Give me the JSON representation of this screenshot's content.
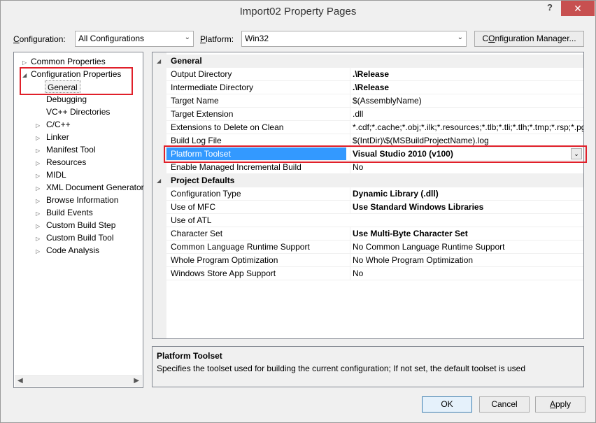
{
  "window": {
    "title": "Import02 Property Pages",
    "help_label": "?",
    "close_label": "✕"
  },
  "toolbar": {
    "configuration_label_prefix": "",
    "configuration_label_mnemonic": "C",
    "configuration_label_rest": "onfiguration:",
    "configuration_value": "All Configurations",
    "platform_label_mnemonic": "P",
    "platform_label_rest": "latform:",
    "platform_value": "Win32",
    "config_manager_mnemonic": "O",
    "config_manager_label_rest": "nfiguration Manager...",
    "config_manager_prefix": "C"
  },
  "tree": {
    "items": [
      {
        "label": "Common Properties",
        "twisty": "▷"
      },
      {
        "label": "Configuration Properties",
        "twisty": "◢"
      },
      {
        "label": "General",
        "twisty": ""
      },
      {
        "label": "Debugging",
        "twisty": ""
      },
      {
        "label": "VC++ Directories",
        "twisty": ""
      },
      {
        "label": "C/C++",
        "twisty": "▷"
      },
      {
        "label": "Linker",
        "twisty": "▷"
      },
      {
        "label": "Manifest Tool",
        "twisty": "▷"
      },
      {
        "label": "Resources",
        "twisty": "▷"
      },
      {
        "label": "MIDL",
        "twisty": "▷"
      },
      {
        "label": "XML Document Generator",
        "twisty": "▷"
      },
      {
        "label": "Browse Information",
        "twisty": "▷"
      },
      {
        "label": "Build Events",
        "twisty": "▷"
      },
      {
        "label": "Custom Build Step",
        "twisty": "▷"
      },
      {
        "label": "Custom Build Tool",
        "twisty": "▷"
      },
      {
        "label": "Code Analysis",
        "twisty": "▷"
      }
    ],
    "scroll_left": "◀",
    "scroll_right": "▶"
  },
  "grid": {
    "general_title": "General",
    "project_defaults_title": "Project Defaults",
    "general_rows": [
      {
        "name": "Output Directory",
        "value": ".\\Release"
      },
      {
        "name": "Intermediate Directory",
        "value": ".\\Release"
      },
      {
        "name": "Target Name",
        "value": "$(AssemblyName)"
      },
      {
        "name": "Target Extension",
        "value": ".dll"
      },
      {
        "name": "Extensions to Delete on Clean",
        "value": "*.cdf;*.cache;*.obj;*.ilk;*.resources;*.tlb;*.tli;*.tlh;*.tmp;*.rsp;*.pgc;*.p"
      },
      {
        "name": "Build Log File",
        "value": "$(IntDir)\\$(MSBuildProjectName).log"
      },
      {
        "name": "Platform Toolset",
        "value": "Visual Studio 2010 (v100)"
      },
      {
        "name": "Enable Managed Incremental Build",
        "value": "No"
      }
    ],
    "defaults_rows": [
      {
        "name": "Configuration Type",
        "value": "Dynamic Library (.dll)"
      },
      {
        "name": "Use of MFC",
        "value": "Use Standard Windows Libraries"
      },
      {
        "name": "Use of ATL",
        "value": ""
      },
      {
        "name": "Character Set",
        "value": "Use Multi-Byte Character Set"
      },
      {
        "name": "Common Language Runtime Support",
        "value": "No Common Language Runtime Support"
      },
      {
        "name": "Whole Program Optimization",
        "value": "No Whole Program Optimization"
      },
      {
        "name": "Windows Store App Support",
        "value": "No"
      }
    ]
  },
  "description": {
    "title": "Platform Toolset",
    "text": "Specifies the toolset used for building the current configuration; If not set, the default toolset is used"
  },
  "buttons": {
    "ok": "OK",
    "cancel": "Cancel",
    "apply_mnemonic": "A",
    "apply_rest": "pply"
  },
  "colors": {
    "selection": "#3399ff",
    "highlight_box": "#e0202a",
    "close_button": "#c75050"
  }
}
